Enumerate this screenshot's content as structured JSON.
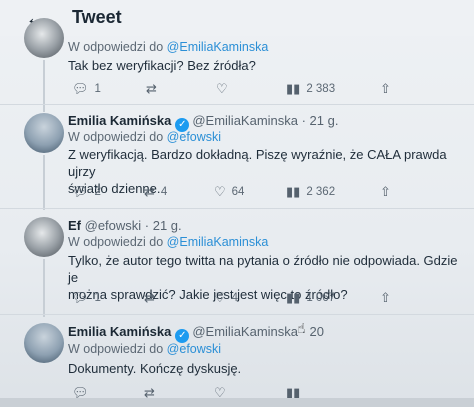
{
  "header": {
    "title": "Tweet",
    "back_icon": "arrow-left-icon"
  },
  "tweets": [
    {
      "reply_prefix": "W odpowiedzi do ",
      "reply_mention": "@EmiliaKaminska",
      "text": "Tak bez weryfikacji? Bez źródła?",
      "actions": {
        "replies": "1",
        "retweets": "",
        "likes": "",
        "views": "2 383"
      }
    },
    {
      "name": "Emilia Kamińska",
      "handle_time": "@EmiliaKaminska · 21 g.",
      "reply_prefix": "W odpowiedzi do ",
      "reply_mention": "@efowski",
      "text_line1": "Z weryfikacją. Bardzo dokładną. Piszę wyraźnie, że CAŁA prawda ujrzy",
      "text_line2": "światło dzienne.",
      "actions": {
        "replies": "2",
        "retweets": "4",
        "likes": "64",
        "views": "2 362"
      }
    },
    {
      "name": "Ef",
      "handle_time": "@efowski · 21 g.",
      "reply_prefix": "W odpowiedzi do ",
      "reply_mention": "@EmiliaKaminska",
      "text_line1": "Tylko, że autor tego twitta na pytania o źródło nie odpowiada. Gdzie je",
      "text_line2": "można sprawdzić?  Jakie jest jest więc to źródło?",
      "actions": {
        "replies": "1",
        "retweets": "",
        "likes": "4",
        "views": "1 067"
      }
    },
    {
      "name": "Emilia Kamińska",
      "handle_time": "@EmiliaKaminska · 20",
      "reply_prefix": "W odpowiedzi do ",
      "reply_mention": "@efowski",
      "text": "Dokumenty. Kończę dyskusję."
    }
  ]
}
